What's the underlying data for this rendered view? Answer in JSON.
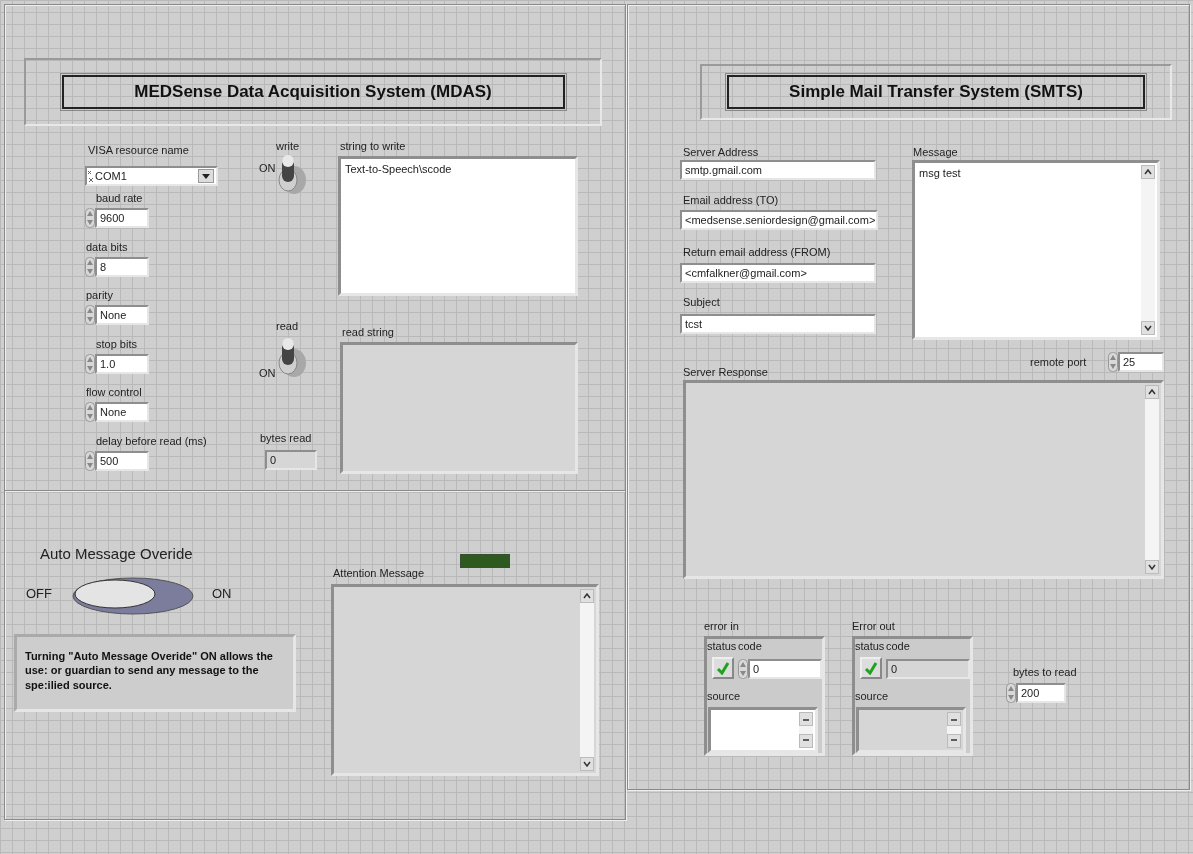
{
  "mdas": {
    "title": "MEDSense Data Acquisition System (MDAS)",
    "visa": {
      "label": "VISA resource name",
      "value": "COM1"
    },
    "settings": [
      {
        "label": "baud rate",
        "value": "9600"
      },
      {
        "label": "data bits",
        "value": "8"
      },
      {
        "label": "parity",
        "value": "None"
      },
      {
        "label": "stop bits",
        "value": "1.0"
      },
      {
        "label": "flow control",
        "value": "None"
      },
      {
        "label": "delay before read (ms)",
        "value": "500"
      }
    ],
    "switches": [
      {
        "label": "write",
        "state_text": "ON",
        "on": true
      },
      {
        "label": "read",
        "state_text": "ON",
        "on": true
      }
    ],
    "string_to_write": {
      "label": "string to write",
      "value": "Text-to-Speech\\scode"
    },
    "read_string": {
      "label": "read string"
    },
    "bytes_read": {
      "label": "bytes read",
      "value": "0"
    }
  },
  "override": {
    "title": "Auto Message Overide",
    "off_text": "OFF",
    "on_text": "ON",
    "on": false,
    "note": "Turning \"Auto Message Overide\" ON allows the use: or guardian to send any message to the spe:ilied source."
  },
  "attention": {
    "label": "Attention Message",
    "led_on": false
  },
  "smts": {
    "title": "Simple Mail Transfer System (SMTS)",
    "fields": [
      {
        "label": "Server Address",
        "value": "smtp.gmail.com"
      },
      {
        "label": "Email address (TO)",
        "value": "<medsense.seniordesign@gmail.com>"
      },
      {
        "label": "Return email address (FROM)",
        "value": "<cmfalkner@gmail.com>"
      },
      {
        "label": "Subject",
        "value": "tcst"
      }
    ],
    "message": {
      "label": "Message",
      "value": "msg test"
    },
    "remote_port": {
      "label": "remote port",
      "value": "25"
    },
    "server_response": {
      "label": "Server Response"
    },
    "error_clusters": [
      {
        "label": "error in",
        "status_label": "status",
        "code_label": "code",
        "code": "0",
        "source_label": "source",
        "status": false,
        "editable": true
      },
      {
        "label": "Error out",
        "status_label": "status",
        "code_label": "code",
        "code": "0",
        "source_label": "source",
        "status": false,
        "editable": false
      }
    ],
    "bytes_to_read": {
      "label": "bytes to read",
      "value": "200"
    }
  }
}
